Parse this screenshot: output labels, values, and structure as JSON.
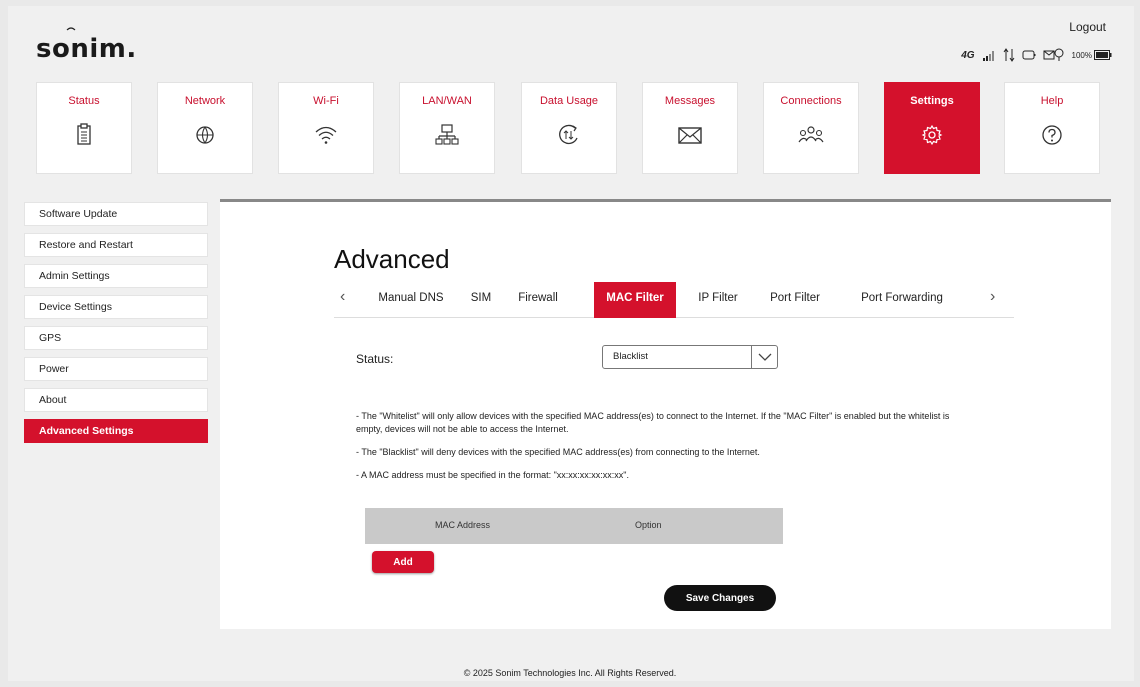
{
  "header": {
    "logo": "sonim.",
    "logout": "Logout",
    "network_type": "4G",
    "battery": "100%"
  },
  "nav": {
    "tiles": [
      {
        "label": "Status",
        "icon": "clipboard-icon"
      },
      {
        "label": "Network",
        "icon": "globe-icon"
      },
      {
        "label": "Wi-Fi",
        "icon": "wifi-icon"
      },
      {
        "label": "LAN/WAN",
        "icon": "lan-icon"
      },
      {
        "label": "Data Usage",
        "icon": "data-usage-icon"
      },
      {
        "label": "Messages",
        "icon": "envelope-icon"
      },
      {
        "label": "Connections",
        "icon": "users-icon"
      },
      {
        "label": "Settings",
        "icon": "gear-icon"
      },
      {
        "label": "Help",
        "icon": "help-icon"
      }
    ],
    "active": "Settings"
  },
  "sidebar": {
    "items": [
      {
        "label": "Software Update"
      },
      {
        "label": "Restore and Restart"
      },
      {
        "label": "Admin Settings"
      },
      {
        "label": "Device Settings"
      },
      {
        "label": "GPS"
      },
      {
        "label": "Power"
      },
      {
        "label": "About"
      },
      {
        "label": "Advanced Settings"
      }
    ],
    "active": "Advanced Settings"
  },
  "main": {
    "title": "Advanced",
    "tabs": [
      {
        "label": "Manual DNS"
      },
      {
        "label": "SIM"
      },
      {
        "label": "Firewall"
      },
      {
        "label": "MAC Filter"
      },
      {
        "label": "IP Filter"
      },
      {
        "label": "Port Filter"
      },
      {
        "label": "Port Forwarding"
      }
    ],
    "active_tab": "MAC Filter",
    "status_label": "Status:",
    "status_value": "Blacklist",
    "notes": [
      "- The \"Whitelist\" will only allow devices with the specified MAC address(es) to connect to the Internet. If the \"MAC Filter\" is enabled but the whitelist is empty, devices will not be able to access the Internet.",
      "- The \"Blacklist\" will deny devices with the specified MAC address(es) from connecting to the Internet.",
      "- A MAC address must be specified in the format: \"xx:xx:xx:xx:xx:xx\"."
    ],
    "table_headers": [
      "MAC Address",
      "Option"
    ],
    "add_label": "Add",
    "save_label": "Save Changes"
  },
  "footer": "© 2025 Sonim Technologies Inc. All Rights Reserved.",
  "colors": {
    "accent": "#d4112c",
    "background": "#f0f0f0"
  }
}
